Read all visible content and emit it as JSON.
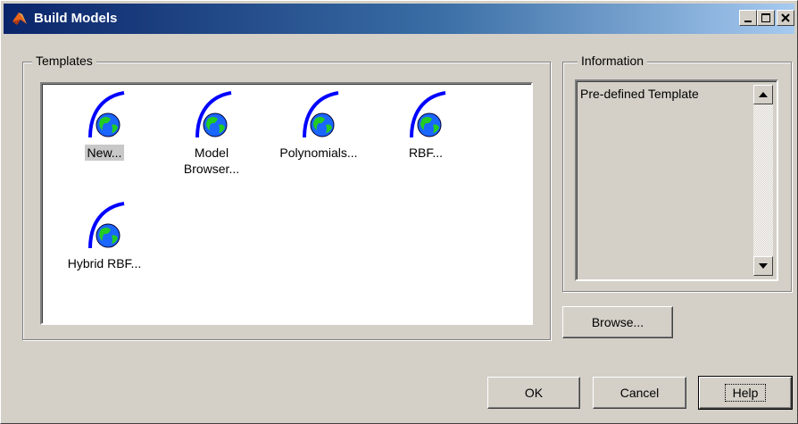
{
  "window": {
    "title": "Build Models"
  },
  "templates": {
    "label": "Templates",
    "items": [
      {
        "label_lines": [
          "New..."
        ],
        "selected": true
      },
      {
        "label_lines": [
          "Model",
          "Browser..."
        ]
      },
      {
        "label_lines": [
          "Polynomials..."
        ]
      },
      {
        "label_lines": [
          "RBF..."
        ]
      },
      {
        "label_lines": [
          "Hybrid RBF..."
        ]
      }
    ]
  },
  "information": {
    "label": "Information",
    "text": "Pre-defined Template"
  },
  "buttons": {
    "browse": "Browse...",
    "ok": "OK",
    "cancel": "Cancel",
    "help": "Help"
  },
  "icons": {
    "app": "matlab-logo-icon",
    "template": "globe-template-icon",
    "minimize": "minimize-icon",
    "maximize": "maximize-icon",
    "close": "close-icon"
  },
  "colors": {
    "title_start": "#0a246a",
    "title_end": "#a6caf0",
    "globe_arc": "#0000ff",
    "globe_sea": "#1a66ff",
    "globe_land": "#22cc22"
  }
}
